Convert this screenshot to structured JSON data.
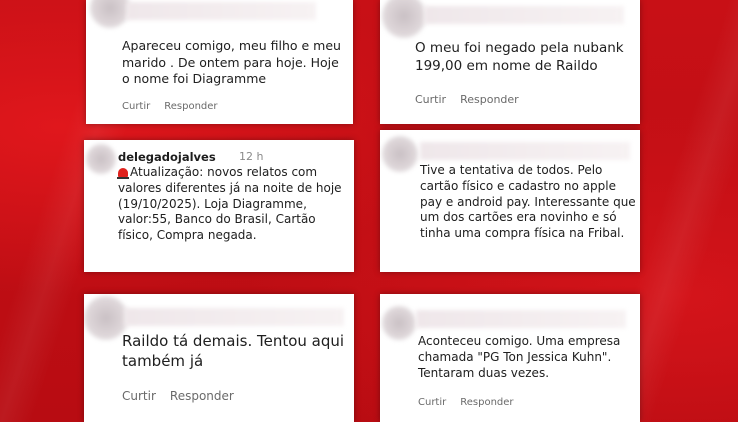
{
  "comments": [
    {
      "text": "Apareceu comigo, meu filho e meu marido . De ontem para hoje. Hoje o nome foi Diagramme",
      "like": "Curtir",
      "reply": "Responder"
    },
    {
      "text": "O meu foi negado pela nubank 199,00 em nome de Raildo",
      "like": "Curtir",
      "reply": "Responder"
    },
    {
      "username": "delegadojalves",
      "time": "12 h",
      "text": "Atualização: novos relatos com valores diferentes já na noite de hoje (19/10/2025). Loja Diagramme, valor:55, Banco do Brasil, Cartão físico, Compra negada."
    },
    {
      "text": "Tive a tentativa de todos. Pelo cartão físico e cadastro no apple pay e android pay. Interessante que um dos cartões era novinho e só tinha uma compra física na Fribal."
    },
    {
      "text": "Raildo tá demais. Tentou aqui também já",
      "like": "Curtir",
      "reply": "Responder"
    },
    {
      "text": "Aconteceu comigo. Uma empresa chamada \"PG Ton Jessica Kuhn\". Tentaram duas vezes.",
      "like": "Curtir",
      "reply": "Responder"
    }
  ],
  "colors": {
    "background": "#c40d12",
    "card": "#ffffff",
    "text": "#202020",
    "action": "#6a6a6a"
  }
}
